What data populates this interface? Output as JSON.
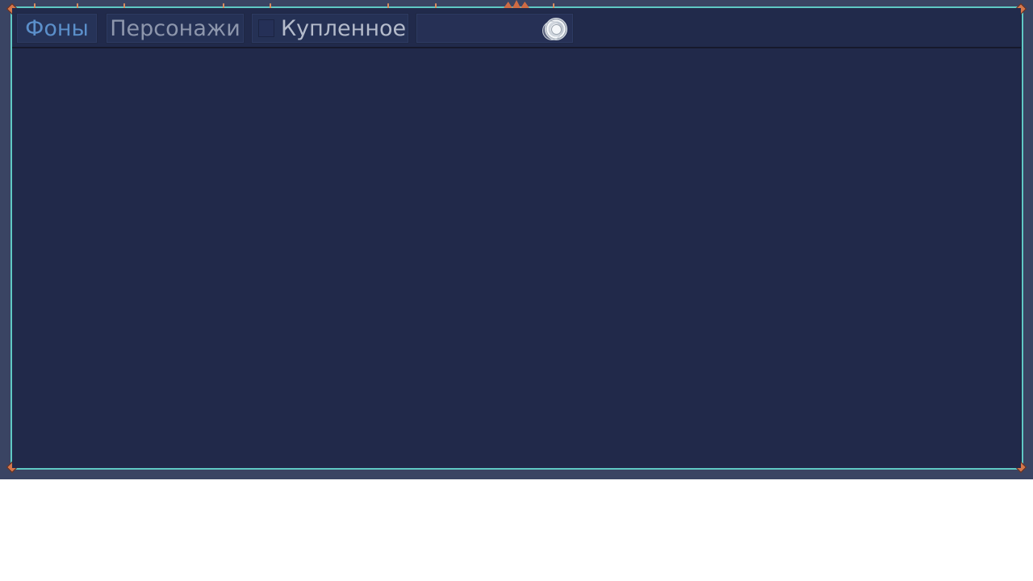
{
  "tabs": {
    "backgrounds": "Фоны",
    "characters": "Персонажи",
    "purchased": "Купленное"
  },
  "currency": {
    "value": "",
    "icon": "coin-icon"
  },
  "colors": {
    "frame": "#5fc8c4",
    "panel": "#21294a",
    "active_tab_text": "#5b8fca",
    "inactive_tab_text": "#8d96ac",
    "accent": "#d4764b"
  }
}
